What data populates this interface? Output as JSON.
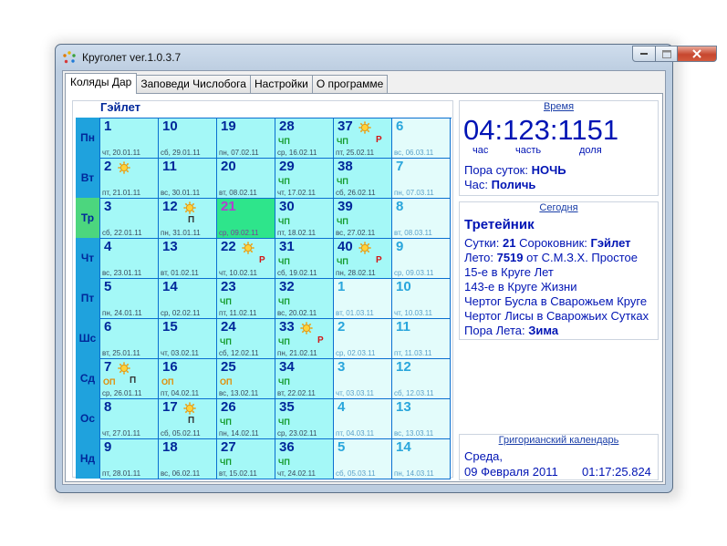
{
  "window": {
    "title": "Круголет ver.1.0.3.7"
  },
  "tabs": [
    {
      "label": "Коляды Дар",
      "active": true
    },
    {
      "label": "Заповеди Числобога"
    },
    {
      "label": "Настройки"
    },
    {
      "label": "О программе"
    }
  ],
  "calendar": {
    "month": "Гэйлет",
    "weekdays": [
      "Пн",
      "Вт",
      "Тр",
      "Чт",
      "Пт",
      "Шс",
      "Сд",
      "Ос",
      "Нд"
    ],
    "today_weekday_index": 2,
    "columns": [
      [
        {
          "num": "1",
          "date": "чт, 20.01.11"
        },
        {
          "num": "2",
          "date": "пт, 21.01.11",
          "sun": true
        },
        {
          "num": "3",
          "date": "сб, 22.01.11"
        },
        {
          "num": "4",
          "date": "вс, 23.01.11"
        },
        {
          "num": "5",
          "date": "пн, 24.01.11"
        },
        {
          "num": "6",
          "date": "вт, 25.01.11"
        },
        {
          "num": "7",
          "date": "ср, 26.01.11",
          "sun": true,
          "op": "ОП",
          "p": "П"
        },
        {
          "num": "8",
          "date": "чт, 27.01.11"
        },
        {
          "num": "9",
          "date": "пт, 28.01.11"
        }
      ],
      [
        {
          "num": "10",
          "date": "сб, 29.01.11"
        },
        {
          "num": "11",
          "date": "вс, 30.01.11"
        },
        {
          "num": "12",
          "date": "пн, 31.01.11",
          "sun": true,
          "p": "П"
        },
        {
          "num": "13",
          "date": "вт, 01.02.11"
        },
        {
          "num": "14",
          "date": "ср, 02.02.11"
        },
        {
          "num": "15",
          "date": "чт, 03.02.11"
        },
        {
          "num": "16",
          "date": "пт, 04.02.11",
          "op": "ОП"
        },
        {
          "num": "17",
          "date": "сб, 05.02.11",
          "sun": true,
          "p": "П"
        },
        {
          "num": "18",
          "date": "вс, 06.02.11"
        }
      ],
      [
        {
          "num": "19",
          "date": "пн, 07.02.11"
        },
        {
          "num": "20",
          "date": "вт, 08.02.11"
        },
        {
          "num": "21",
          "date": "ср, 09.02.11",
          "today": true
        },
        {
          "num": "22",
          "date": "чт, 10.02.11",
          "sun": true,
          "r": "Р"
        },
        {
          "num": "23",
          "date": "пт, 11.02.11",
          "chp": "ЧП"
        },
        {
          "num": "24",
          "date": "сб, 12.02.11",
          "chp": "ЧП"
        },
        {
          "num": "25",
          "date": "вс, 13.02.11",
          "op": "ОП"
        },
        {
          "num": "26",
          "date": "пн, 14.02.11",
          "chp": "ЧП"
        },
        {
          "num": "27",
          "date": "вт, 15.02.11",
          "chp": "ЧП"
        }
      ],
      [
        {
          "num": "28",
          "date": "ср, 16.02.11",
          "chp": "ЧП"
        },
        {
          "num": "29",
          "date": "чт, 17.02.11",
          "chp": "ЧП"
        },
        {
          "num": "30",
          "date": "пт, 18.02.11",
          "chp": "ЧП"
        },
        {
          "num": "31",
          "date": "сб, 19.02.11",
          "chp": "ЧП"
        },
        {
          "num": "32",
          "date": "вс, 20.02.11",
          "chp": "ЧП"
        },
        {
          "num": "33",
          "date": "пн, 21.02.11",
          "sun": true,
          "chp": "ЧП",
          "r": "Р"
        },
        {
          "num": "34",
          "date": "вт, 22.02.11",
          "chp": "ЧП"
        },
        {
          "num": "35",
          "date": "ср, 23.02.11",
          "chp": "ЧП"
        },
        {
          "num": "36",
          "date": "чт, 24.02.11",
          "chp": "ЧП"
        }
      ],
      [
        {
          "num": "37",
          "date": "пт, 25.02.11",
          "sun": true,
          "chp": "ЧП",
          "r": "Р"
        },
        {
          "num": "38",
          "date": "сб, 26.02.11",
          "chp": "ЧП"
        },
        {
          "num": "39",
          "date": "вс, 27.02.11",
          "chp": "ЧП"
        },
        {
          "num": "40",
          "date": "пн, 28.02.11",
          "sun": true,
          "chp": "ЧП",
          "r": "Р"
        },
        {
          "num": "1",
          "date": "вт, 01.03.11",
          "light": true
        },
        {
          "num": "2",
          "date": "ср, 02.03.11",
          "light": true
        },
        {
          "num": "3",
          "date": "чт, 03.03.11",
          "light": true
        },
        {
          "num": "4",
          "date": "пт, 04.03.11",
          "light": true
        },
        {
          "num": "5",
          "date": "сб, 05.03.11",
          "light": true
        }
      ],
      [
        {
          "num": "6",
          "date": "вс, 06.03.11",
          "light": true
        },
        {
          "num": "7",
          "date": "пн, 07.03.11",
          "light": true
        },
        {
          "num": "8",
          "date": "вт, 08.03.11",
          "light": true
        },
        {
          "num": "9",
          "date": "ср, 09.03.11",
          "light": true
        },
        {
          "num": "10",
          "date": "чт, 10.03.11",
          "light": true
        },
        {
          "num": "11",
          "date": "пт, 11.03.11",
          "light": true
        },
        {
          "num": "12",
          "date": "сб, 12.03.11",
          "light": true
        },
        {
          "num": "13",
          "date": "вс, 13.03.11",
          "light": true
        },
        {
          "num": "14",
          "date": "пн, 14.03.11",
          "light": true
        }
      ]
    ]
  },
  "time_panel": {
    "link": "Время",
    "big": "04:123:1151",
    "labels": [
      "час",
      "часть",
      "доля"
    ],
    "period_label": "Пора суток: ",
    "period_value": "НОЧЬ",
    "hour_label": "Час: ",
    "hour_value": "Поличь"
  },
  "today_panel": {
    "link": "Сегодня",
    "day_name": "Третейник",
    "sutki_label": "Сутки: ",
    "sutki_value": "21",
    "sorok_label": " Сороковник: ",
    "sorok_value": "Гэйлет",
    "leto_label": "Лето: ",
    "leto_value": "7519",
    "leto_rest": " от С.М.З.Х. Простое",
    "line_krug_let": "15-е в Круге Лет",
    "line_krug_zhizni": "143-е в Круге Жизни",
    "line_chertog1": "Чертог Бусла в Сварожьем Круге",
    "line_chertog2": "Чертог Лисы в Сварожьих Сутках",
    "pora_leta_label": "Пора Лета: ",
    "pora_leta_value": "Зима"
  },
  "gregorian_panel": {
    "link": "Григорианский календарь",
    "weekday": "Среда,",
    "date": "09 Февраля 2011",
    "time": "01:17:25.824"
  }
}
